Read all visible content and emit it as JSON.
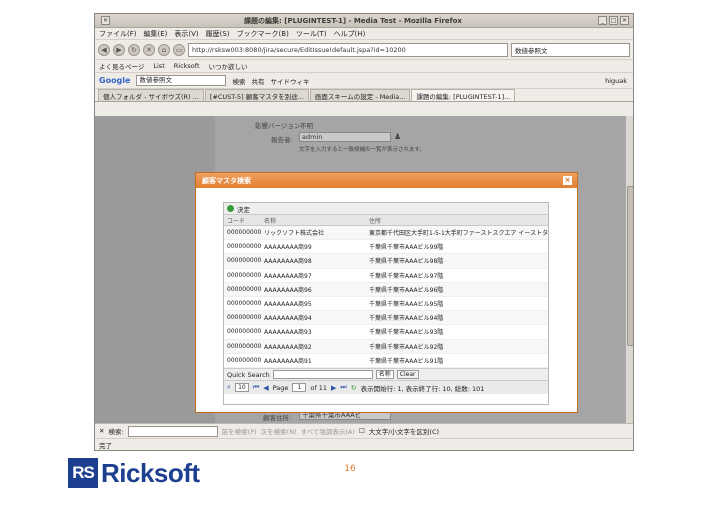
{
  "window": {
    "title": "課題の編集: [PLUGINTEST-1] - Media Test - Mozilla Firefox"
  },
  "menu": [
    "ファイル(F)",
    "編集(E)",
    "表示(V)",
    "履歴(S)",
    "ブックマーク(B)",
    "ツール(T)",
    "ヘルプ(H)"
  ],
  "nav": {
    "url": "http://rsksw003:8080/jira/secure/EditIssue!default.jspa?id=10200",
    "search_placeholder": "数値参照文"
  },
  "bookmarks": [
    "よく見るページ",
    "List",
    "Ricksoft",
    "いつか欲しい"
  ],
  "google_bar": {
    "logo": "Google",
    "query": "数値参照文",
    "items": [
      "検索",
      "共有",
      "サイドウィキ",
      "higuak"
    ]
  },
  "tabs": [
    "個人フォルダ - サイボウズ(R) ...",
    "[#CUST-5] 顧客マスタを別途...",
    "画面スキームの設定 - Media...",
    "課題の編集: [PLUGINTEST-1]..."
  ],
  "form": {
    "version_label": "影響バージョン:",
    "version_value": "不明",
    "reporter_label": "報告者:",
    "reporter_value": "admin",
    "reporter_hint": "文字を入力すると一致候補の一覧が表示されます。",
    "address_label": "顧客住所:",
    "address_value": "千葉県千葉市AAAビ"
  },
  "dialog": {
    "title": "顧客マスタ検索",
    "close": "×",
    "confirm_label": "決定",
    "columns": [
      "コード",
      "名称",
      "住所"
    ],
    "rows": [
      [
        "00000000000",
        "リックソフト株式会社",
        "東京都千代田区大手町1-5-1大手町ファーストスクエア イーストタワー"
      ],
      [
        "00000000000",
        "AAAAAAAA商99",
        "千葉県千葉市AAAビル99階"
      ],
      [
        "00000000000",
        "AAAAAAAA商98",
        "千葉県千葉市AAAビル98階"
      ],
      [
        "00000000000",
        "AAAAAAAA商97",
        "千葉県千葉市AAAビル97階"
      ],
      [
        "00000000000",
        "AAAAAAAA商96",
        "千葉県千葉市AAAビル96階"
      ],
      [
        "00000000000",
        "AAAAAAAA商95",
        "千葉県千葉市AAAビル95階"
      ],
      [
        "00000000000",
        "AAAAAAAA商94",
        "千葉県千葉市AAAビル94階"
      ],
      [
        "00000000000",
        "AAAAAAAA商93",
        "千葉県千葉市AAAビル93階"
      ],
      [
        "00000000000",
        "AAAAAAAA商92",
        "千葉県千葉市AAAビル92階"
      ],
      [
        "00000000000",
        "AAAAAAAA商91",
        "千葉県千葉市AAAビル91階"
      ]
    ],
    "quick_search_label": "Quick Search",
    "field_select": "名称",
    "clear_button": "Clear",
    "page_size": "10",
    "page_label": "Page",
    "page_value": "1",
    "of_pages": "of 11",
    "display_info": "表示開始行: 1, 表示終了行: 10, 総数: 101"
  },
  "findbar": {
    "label": "検索:",
    "prev": "前を検索(P)",
    "next": "次を検索(N)",
    "highlight": "すべて強調表示(A)",
    "match_case": "大文字/小文字を区別(C)"
  },
  "status": "完了",
  "slide": {
    "logo_box": "RS",
    "logo_text": "Ricksoft",
    "page_number": "16"
  }
}
